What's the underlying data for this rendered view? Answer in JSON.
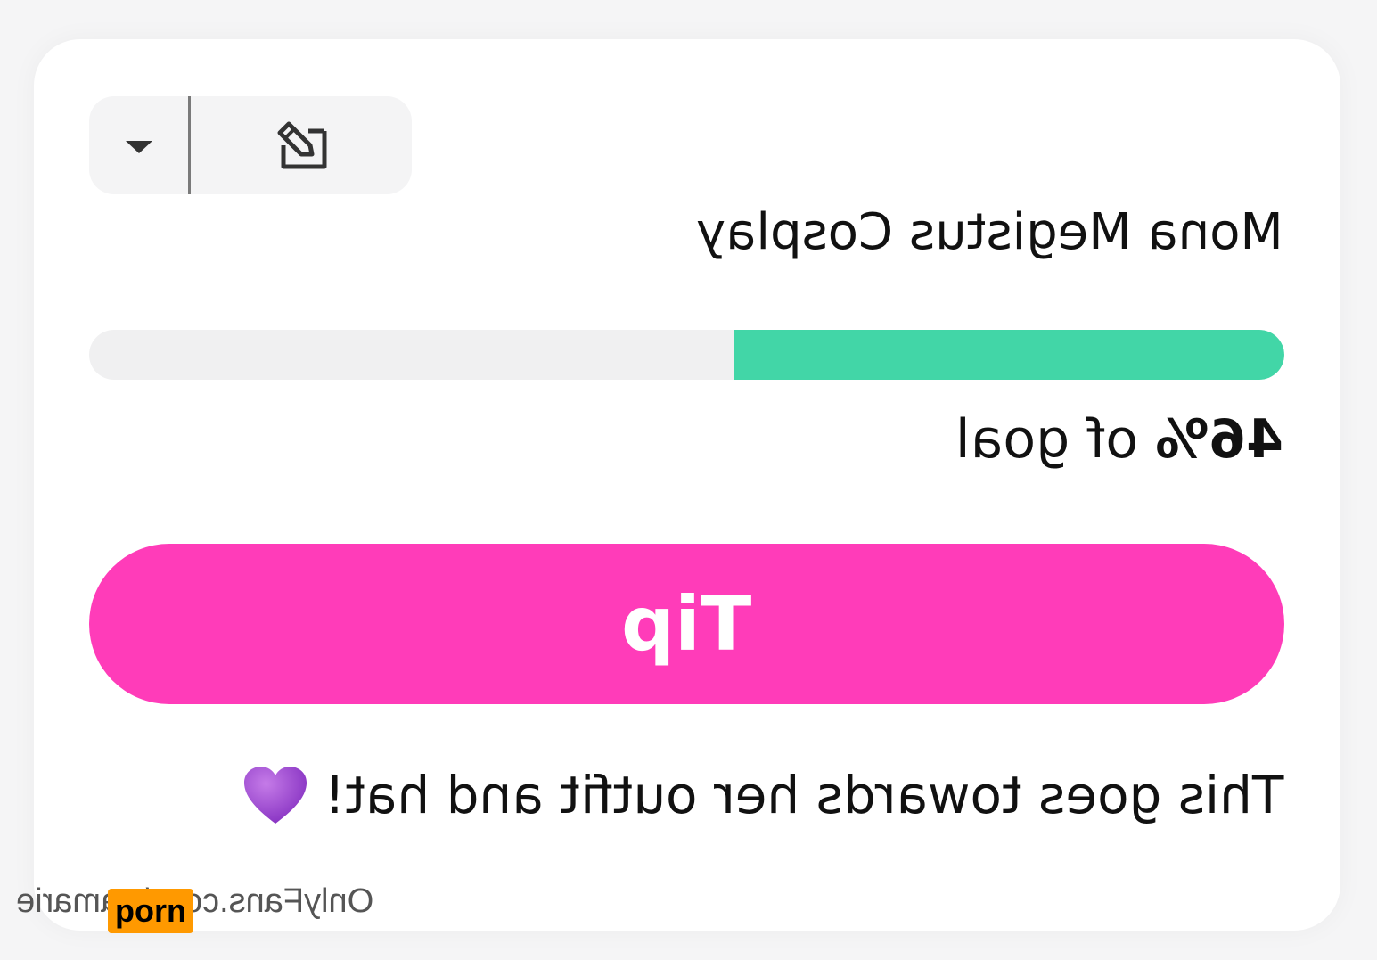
{
  "toolbar": {
    "dropdown_icon": "caret-down-icon",
    "edit_icon": "edit-icon"
  },
  "goal_card": {
    "title": "Mona Megistus Cosplay",
    "progress_fraction": 0.46,
    "progress_label_value": "46%",
    "progress_label_suffix": " of goal",
    "tip_button_label": "Tip",
    "description": "This goes towards her outfit and hat!",
    "heart_icon": "purple-heart-icon"
  },
  "colors": {
    "progress_fill": "#42d6a7",
    "tip_button": "#ff3cb9",
    "heart": "#a64bd6"
  },
  "watermark": {
    "text": "OnlyFans.com/stamarie",
    "logo_text": "porn"
  }
}
